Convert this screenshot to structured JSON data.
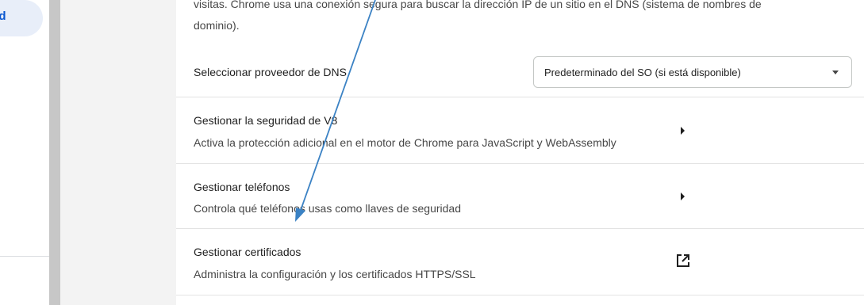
{
  "sidebar": {
    "active_item_label_fragment": "ad"
  },
  "dns": {
    "description": "visitas. Chrome usa una conexión segura para buscar la dirección IP de un sitio en el DNS (sistema de nombres de dominio).",
    "select_label": "Seleccionar proveedor de DNS",
    "selected_value": "Predeterminado del SO (si está disponible)"
  },
  "rows": [
    {
      "title": "Gestionar la seguridad de V8",
      "subtitle": "Activa la protección adicional en el motor de Chrome para JavaScript y WebAssembly",
      "icon": "chevron-right-icon"
    },
    {
      "title": "Gestionar teléfonos",
      "subtitle": "Controla qué teléfonos usas como llaves de seguridad",
      "icon": "chevron-right-icon"
    },
    {
      "title": "Gestionar certificados",
      "subtitle": "Administra la configuración y los certificados HTTPS/SSL",
      "icon": "open-in-new-icon"
    }
  ],
  "annotation": {
    "arrow_color": "#3b82c4"
  },
  "colors": {
    "accent": "#0b57d0",
    "sidebar_active_bg": "#e8eef9",
    "divider": "#e3e3e3"
  }
}
